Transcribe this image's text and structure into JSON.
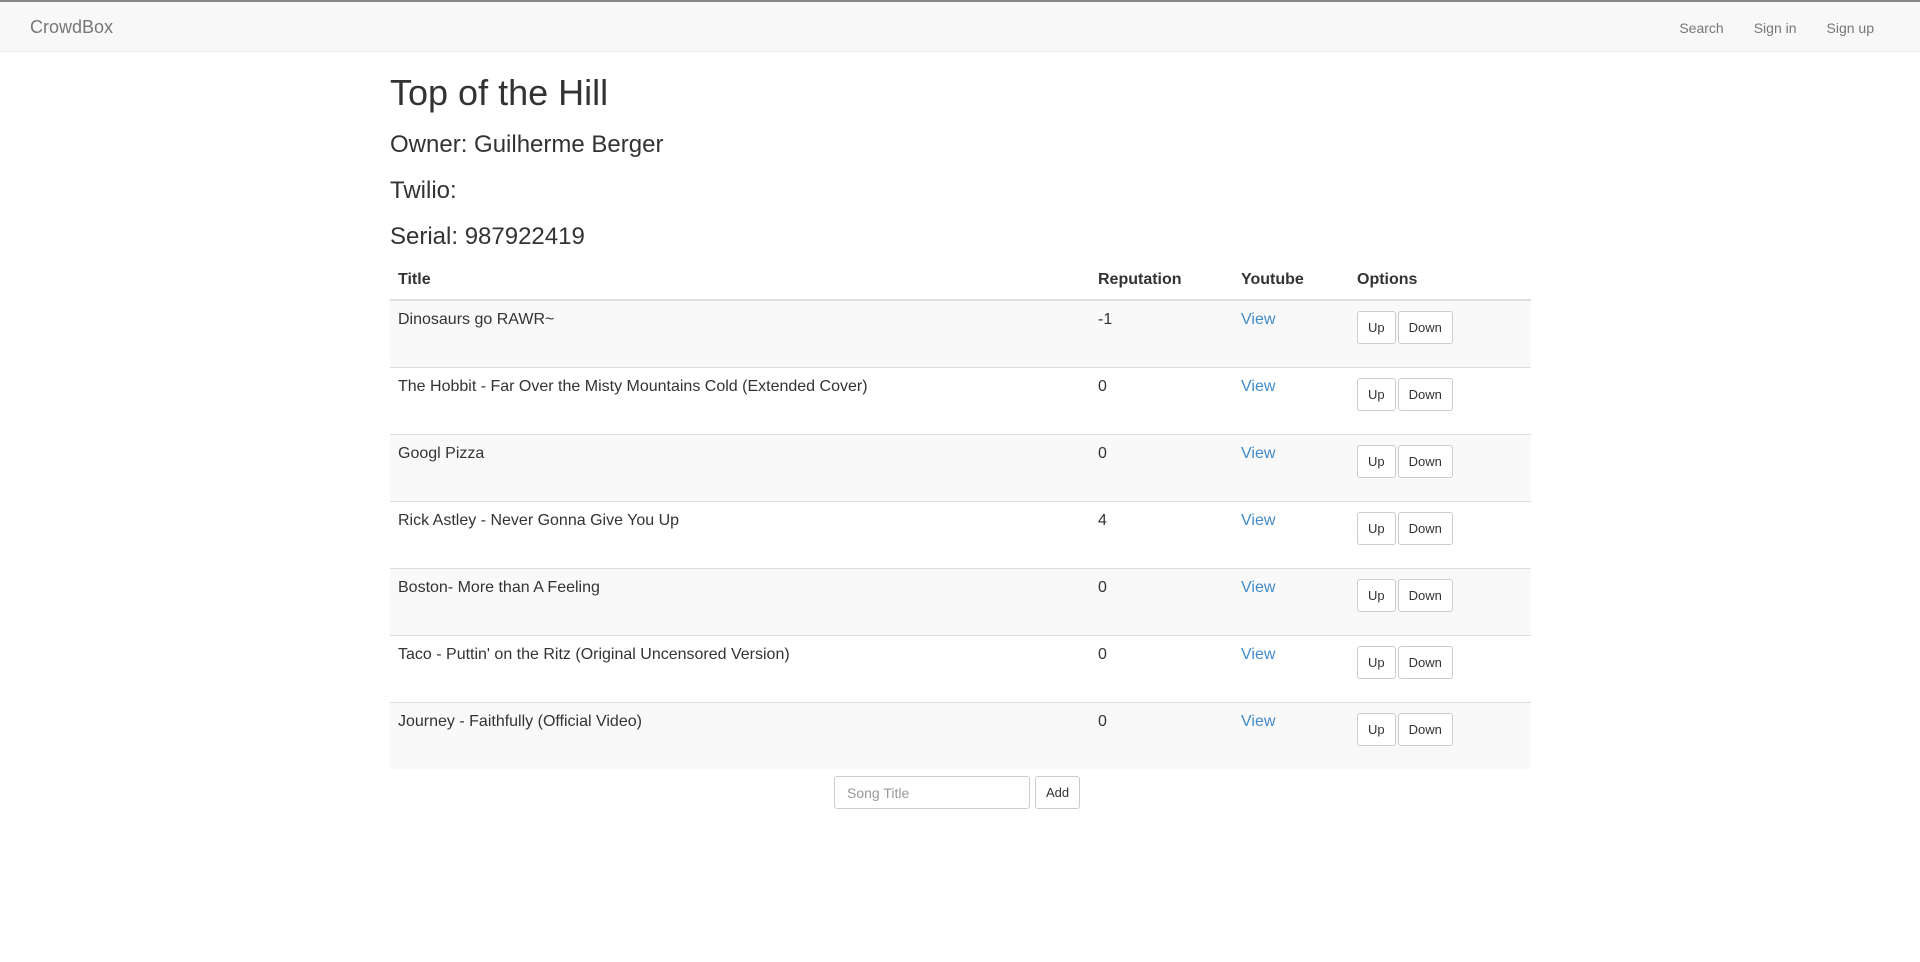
{
  "navbar": {
    "brand": "CrowdBox",
    "links": {
      "search": "Search",
      "sign_in": "Sign in",
      "sign_up": "Sign up"
    }
  },
  "page": {
    "title": "Top of the Hill",
    "owner": "Owner: Guilherme Berger",
    "twilio": "Twilio:",
    "serial": "Serial: 987922419"
  },
  "table": {
    "headers": {
      "title": "Title",
      "reputation": "Reputation",
      "youtube": "Youtube",
      "options": "Options"
    },
    "rows": [
      {
        "title": "Dinosaurs go RAWR~",
        "reputation": "-1",
        "youtube": "View",
        "up": "Up",
        "down": "Down"
      },
      {
        "title": "The Hobbit - Far Over the Misty Mountains Cold (Extended Cover)",
        "reputation": "0",
        "youtube": "View",
        "up": "Up",
        "down": "Down"
      },
      {
        "title": "Googl Pizza",
        "reputation": "0",
        "youtube": "View",
        "up": "Up",
        "down": "Down"
      },
      {
        "title": "Rick Astley - Never Gonna Give You Up",
        "reputation": "4",
        "youtube": "View",
        "up": "Up",
        "down": "Down"
      },
      {
        "title": "Boston- More than A Feeling",
        "reputation": "0",
        "youtube": "View",
        "up": "Up",
        "down": "Down"
      },
      {
        "title": "Taco - Puttin' on the Ritz (Original Uncensored Version)",
        "reputation": "0",
        "youtube": "View",
        "up": "Up",
        "down": "Down"
      },
      {
        "title": "Journey - Faithfully (Official Video)",
        "reputation": "0",
        "youtube": "View",
        "up": "Up",
        "down": "Down"
      }
    ]
  },
  "add_form": {
    "placeholder": "Song Title",
    "value": "",
    "button": "Add"
  },
  "colors": {
    "link": "#428bca",
    "navbar_bg": "#f8f8f8",
    "stripe": "#f9f9f9"
  }
}
